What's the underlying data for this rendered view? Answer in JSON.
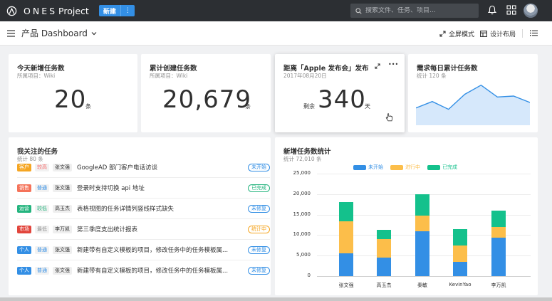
{
  "topbar": {
    "app_name": "ONES",
    "app_suffix": "Project",
    "new_label": "新建",
    "new_more": "⋮",
    "search_placeholder": "搜索文件、任务、项目..."
  },
  "subbar": {
    "title": "产品 Dashboard",
    "fullscreen": "全屏模式",
    "layout": "设计布局"
  },
  "cards": {
    "today_new": {
      "title": "今天新增任务数",
      "subtitle": "所属项目：Wiki",
      "value": "20",
      "unit": "条"
    },
    "total_created": {
      "title": "累计创建任务数",
      "subtitle": "所属项目：Wiki",
      "value": "20,679",
      "unit": "条"
    },
    "countdown": {
      "title": "距离「Apple 发布会」发布",
      "subtitle": "2017年08月20日",
      "prefix": "剩余",
      "value": "340",
      "unit": "天",
      "more": "•••"
    },
    "daily_need": {
      "title": "需求每日累计任务数",
      "subtitle": "统计 120 条",
      "values": [
        38,
        52,
        35,
        68,
        88,
        62,
        64,
        50
      ]
    }
  },
  "task_list": {
    "title": "我关注的任务",
    "subtitle": "统计 80 条",
    "rows": [
      {
        "category": "客户",
        "cat_color": "#f5a623",
        "priority": "较高",
        "pri_color": "#f76b6b",
        "user": "张文强",
        "name": "GoogleAD 部门客户电话访谈",
        "status": "未开始",
        "status_color": "#338fe5"
      },
      {
        "category": "销售",
        "cat_color": "#f5735a",
        "priority": "普通",
        "pri_color": "#338fe5",
        "user": "张文强",
        "name": "登录时支持切换 api 地址",
        "status": "已完成",
        "status_color": "#24b47e"
      },
      {
        "category": "运营",
        "cat_color": "#24b47e",
        "priority": "较低",
        "pri_color": "#24b47e",
        "user": "高玉杰",
        "name": "表格视图的任务详情列竖线样式缺失",
        "status": "未修复",
        "status_color": "#338fe5"
      },
      {
        "category": "市场",
        "cat_color": "#e2453c",
        "priority": "最低",
        "pri_color": "#909090",
        "user": "李万凯",
        "name": "第三季度支出统计报表",
        "status": "统计中",
        "status_color": "#f5a623"
      },
      {
        "category": "个人",
        "cat_color": "#338fe5",
        "priority": "普通",
        "pri_color": "#338fe5",
        "user": "张文强",
        "name": "新建带有自定义模板的项目，修改任务中的任务模板属...",
        "status": "未修复",
        "status_color": "#338fe5"
      },
      {
        "category": "个人",
        "cat_color": "#338fe5",
        "priority": "普通",
        "pri_color": "#338fe5",
        "user": "张文强",
        "name": "新建带有自定义模板的项目，修改任务中的任务模板属...",
        "status": "未修复",
        "status_color": "#338fe5"
      }
    ]
  },
  "chart_card": {
    "title": "新增任务数统计",
    "subtitle": "统计 72,010 条"
  },
  "chart_data": {
    "type": "bar",
    "stacked": true,
    "categories": [
      "张文强",
      "高玉杰",
      "秦敏",
      "KevinYao",
      "李万凯"
    ],
    "series": [
      {
        "name": "未开始",
        "color": "#338fe5",
        "values": [
          5600,
          4500,
          11000,
          3500,
          9400
        ]
      },
      {
        "name": "进行中",
        "color": "#fcbe4a",
        "values": [
          7800,
          4500,
          3800,
          4000,
          2500
        ]
      },
      {
        "name": "已完成",
        "color": "#14c18c",
        "values": [
          4600,
          2200,
          5200,
          4000,
          4000
        ]
      }
    ],
    "yticks": [
      "25,000",
      "20,000",
      "15,000",
      "10,000",
      "5,000",
      "0"
    ],
    "ylim": [
      0,
      25000
    ],
    "legend": "top"
  }
}
